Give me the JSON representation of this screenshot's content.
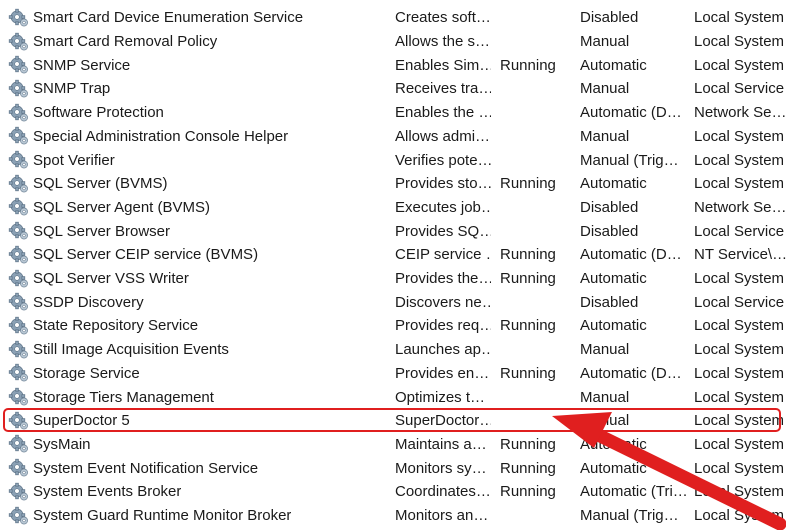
{
  "services": [
    {
      "name": "Smart Card Device Enumeration Service",
      "description": "Creates soft…",
      "status": "",
      "startup": "Disabled",
      "logon": "Local System"
    },
    {
      "name": "Smart Card Removal Policy",
      "description": "Allows the s…",
      "status": "",
      "startup": "Manual",
      "logon": "Local System"
    },
    {
      "name": "SNMP Service",
      "description": "Enables Sim…",
      "status": "Running",
      "startup": "Automatic",
      "logon": "Local System"
    },
    {
      "name": "SNMP Trap",
      "description": "Receives tra…",
      "status": "",
      "startup": "Manual",
      "logon": "Local Service"
    },
    {
      "name": "Software Protection",
      "description": "Enables the …",
      "status": "",
      "startup": "Automatic (D…",
      "logon": "Network Se…"
    },
    {
      "name": "Special Administration Console Helper",
      "description": "Allows admi…",
      "status": "",
      "startup": "Manual",
      "logon": "Local System"
    },
    {
      "name": "Spot Verifier",
      "description": "Verifies pote…",
      "status": "",
      "startup": "Manual (Trig…",
      "logon": "Local System"
    },
    {
      "name": "SQL Server (BVMS)",
      "description": "Provides sto…",
      "status": "Running",
      "startup": "Automatic",
      "logon": "Local System"
    },
    {
      "name": "SQL Server Agent (BVMS)",
      "description": "Executes job…",
      "status": "",
      "startup": "Disabled",
      "logon": "Network Se…"
    },
    {
      "name": "SQL Server Browser",
      "description": "Provides SQ…",
      "status": "",
      "startup": "Disabled",
      "logon": "Local Service"
    },
    {
      "name": "SQL Server CEIP service (BVMS)",
      "description": "CEIP service …",
      "status": "Running",
      "startup": "Automatic (D…",
      "logon": "NT Service\\…"
    },
    {
      "name": "SQL Server VSS Writer",
      "description": "Provides the…",
      "status": "Running",
      "startup": "Automatic",
      "logon": "Local System"
    },
    {
      "name": "SSDP Discovery",
      "description": "Discovers ne…",
      "status": "",
      "startup": "Disabled",
      "logon": "Local Service"
    },
    {
      "name": "State Repository Service",
      "description": "Provides req…",
      "status": "Running",
      "startup": "Automatic",
      "logon": "Local System"
    },
    {
      "name": "Still Image Acquisition Events",
      "description": "Launches ap…",
      "status": "",
      "startup": "Manual",
      "logon": "Local System"
    },
    {
      "name": "Storage Service",
      "description": "Provides en…",
      "status": "Running",
      "startup": "Automatic (D…",
      "logon": "Local System"
    },
    {
      "name": "Storage Tiers Management",
      "description": "Optimizes t…",
      "status": "",
      "startup": "Manual",
      "logon": "Local System"
    },
    {
      "name": "SuperDoctor 5",
      "description": "SuperDoctor…",
      "status": "",
      "startup": "Manual",
      "logon": "Local System",
      "highlighted": true
    },
    {
      "name": "SysMain",
      "description": "Maintains a…",
      "status": "Running",
      "startup": "Automatic",
      "logon": "Local System"
    },
    {
      "name": "System Event Notification Service",
      "description": "Monitors sy…",
      "status": "Running",
      "startup": "Automatic",
      "logon": "Local System"
    },
    {
      "name": "System Events Broker",
      "description": "Coordinates…",
      "status": "Running",
      "startup": "Automatic (Tri…",
      "logon": "Local System"
    },
    {
      "name": "System Guard Runtime Monitor Broker",
      "description": "Monitors an…",
      "status": "",
      "startup": "Manual (Trig…",
      "logon": "Local System"
    }
  ],
  "annotation": {
    "color": "#e01f1f",
    "icon": "gear-service-icon"
  }
}
